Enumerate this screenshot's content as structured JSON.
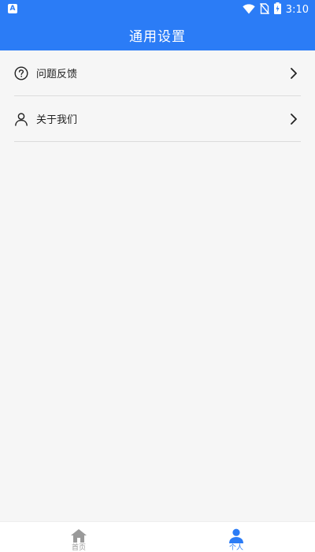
{
  "status_bar": {
    "time": "3:10",
    "left_icon_letter": "A",
    "icons": [
      "app-notification-icon",
      "wifi-icon",
      "no-sim-icon",
      "battery-charging-icon"
    ]
  },
  "header": {
    "title": "通用设置"
  },
  "settings": {
    "items": [
      {
        "label": "问题反馈",
        "icon": "question-circle-icon"
      },
      {
        "label": "关于我们",
        "icon": "person-outline-icon"
      }
    ]
  },
  "bottom_nav": {
    "items": [
      {
        "label": "首页",
        "icon": "home-icon",
        "active": false
      },
      {
        "label": "个人",
        "icon": "person-icon",
        "active": true
      }
    ]
  },
  "colors": {
    "primary": "#2b7cf6",
    "background": "#f6f6f6",
    "text": "#222222",
    "inactive": "#9a9a9a",
    "divider": "#dcdcdc"
  }
}
